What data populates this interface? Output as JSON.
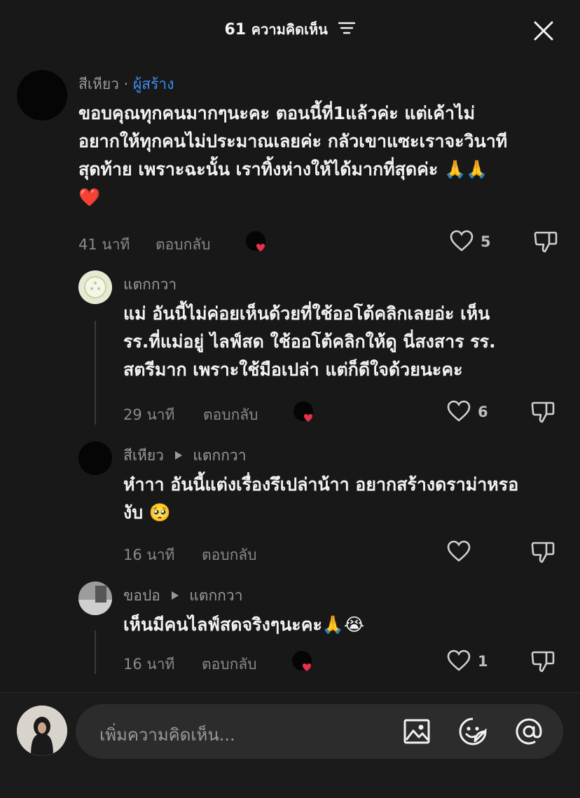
{
  "header": {
    "count": "61",
    "label": "ความคิดเห็น"
  },
  "comments": [
    {
      "author": "สีเหียว",
      "badge_separator": "·",
      "badge": "ผู้สร้าง",
      "text_lines": [
        "ขอบคุณทุกคนมากๆนะคะ ตอนนี้ที่1แล้วค่ะ แต่เค้าไม่",
        "อยากให้ทุกคนไม่ประมาณเลยค่ะ กลัวเขาแซะเราจะวินาที",
        "สุดท้าย เพราะฉะนั้น เราทิ้งห่างให้ได้มากที่สุดค่ะ 🙏🙏",
        "❤️"
      ],
      "time": "41 นาที",
      "reply": "ตอบกลับ",
      "likes": "5"
    },
    {
      "author": "แตกกวา",
      "text_lines": [
        "แม่ อันนี้ไม่ค่อยเห็นด้วยที่ใช้ออโต้คลิกเลยอ่ะ เห็น",
        "รร.ที่แม่อยู่ ไลฟ์สด ใช้ออโต้คลิกให้ดู นี่สงสาร รร.",
        "สตรีมาก เพราะใช้มือเปล่า แต่ก็ดีใจด้วยนะคะ"
      ],
      "time": "29 นาที",
      "reply": "ตอบกลับ",
      "likes": "6"
    },
    {
      "author": "สีเหียว",
      "reply_to": "แตกกวา",
      "text_lines": [
        "ห๋าาา อันนี้แต่งเรื่องรึเปล่าน้าา อยากสร้างดราม่าหรอ",
        "งับ 🥺"
      ],
      "time": "16 นาที",
      "reply": "ตอบกลับ",
      "likes": ""
    },
    {
      "author": "ขอปอ",
      "reply_to": "แตกกวา",
      "text_lines": [
        "เห็นมีคนไลฟ์สดจริงๆนะคะ🙏😭"
      ],
      "time": "16 นาที",
      "reply": "ตอบกลับ",
      "likes": "1"
    }
  ],
  "composer": {
    "placeholder": "เพิ่มความคิดเห็น..."
  },
  "colors": {
    "background": "#181818",
    "creator_badge": "#3d8ef0",
    "heart": "#e8304a"
  },
  "icons": [
    "sort-icon",
    "close-icon",
    "heart-outline-icon",
    "dislike-icon",
    "image-icon",
    "sticker-icon",
    "mention-icon"
  ]
}
